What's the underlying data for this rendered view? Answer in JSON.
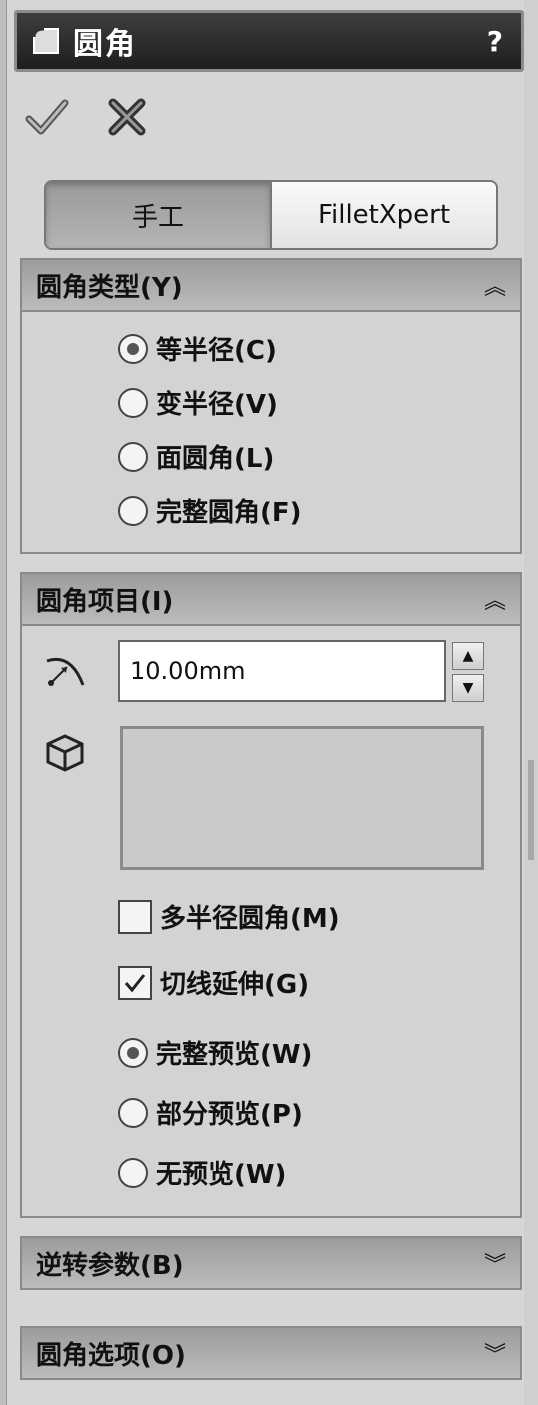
{
  "title": {
    "text": "圆角",
    "help": "?"
  },
  "actions": {
    "ok_icon": "checkmark-icon",
    "cancel_icon": "x-icon"
  },
  "tabs": [
    {
      "label": "手工",
      "active": true
    },
    {
      "label": "FilletXpert",
      "active": false
    }
  ],
  "fillet_type": {
    "header": "圆角类型(Y)",
    "options": [
      {
        "label": "等半径(C)",
        "selected": true
      },
      {
        "label": "变半径(V)",
        "selected": false
      },
      {
        "label": "面圆角(L)",
        "selected": false
      },
      {
        "label": "完整圆角(F)",
        "selected": false
      }
    ]
  },
  "fillet_items": {
    "header": "圆角项目(I)",
    "radius_value": "10.00mm",
    "multi_radius": {
      "label": "多半径圆角(M)",
      "checked": false
    },
    "tangent_propagation": {
      "label": "切线延伸(G)",
      "checked": true
    },
    "preview_options": [
      {
        "label": "完整预览(W)",
        "selected": true
      },
      {
        "label": "部分预览(P)",
        "selected": false
      },
      {
        "label": "无预览(W)",
        "selected": false
      }
    ]
  },
  "setback": {
    "header": "逆转参数(B)"
  },
  "fillet_options": {
    "header": "圆角选项(O)"
  },
  "colors": {
    "title_bg": "#2a2a2a",
    "panel_bg": "#d6d6d6",
    "header_bg": "#aaaaaa"
  }
}
